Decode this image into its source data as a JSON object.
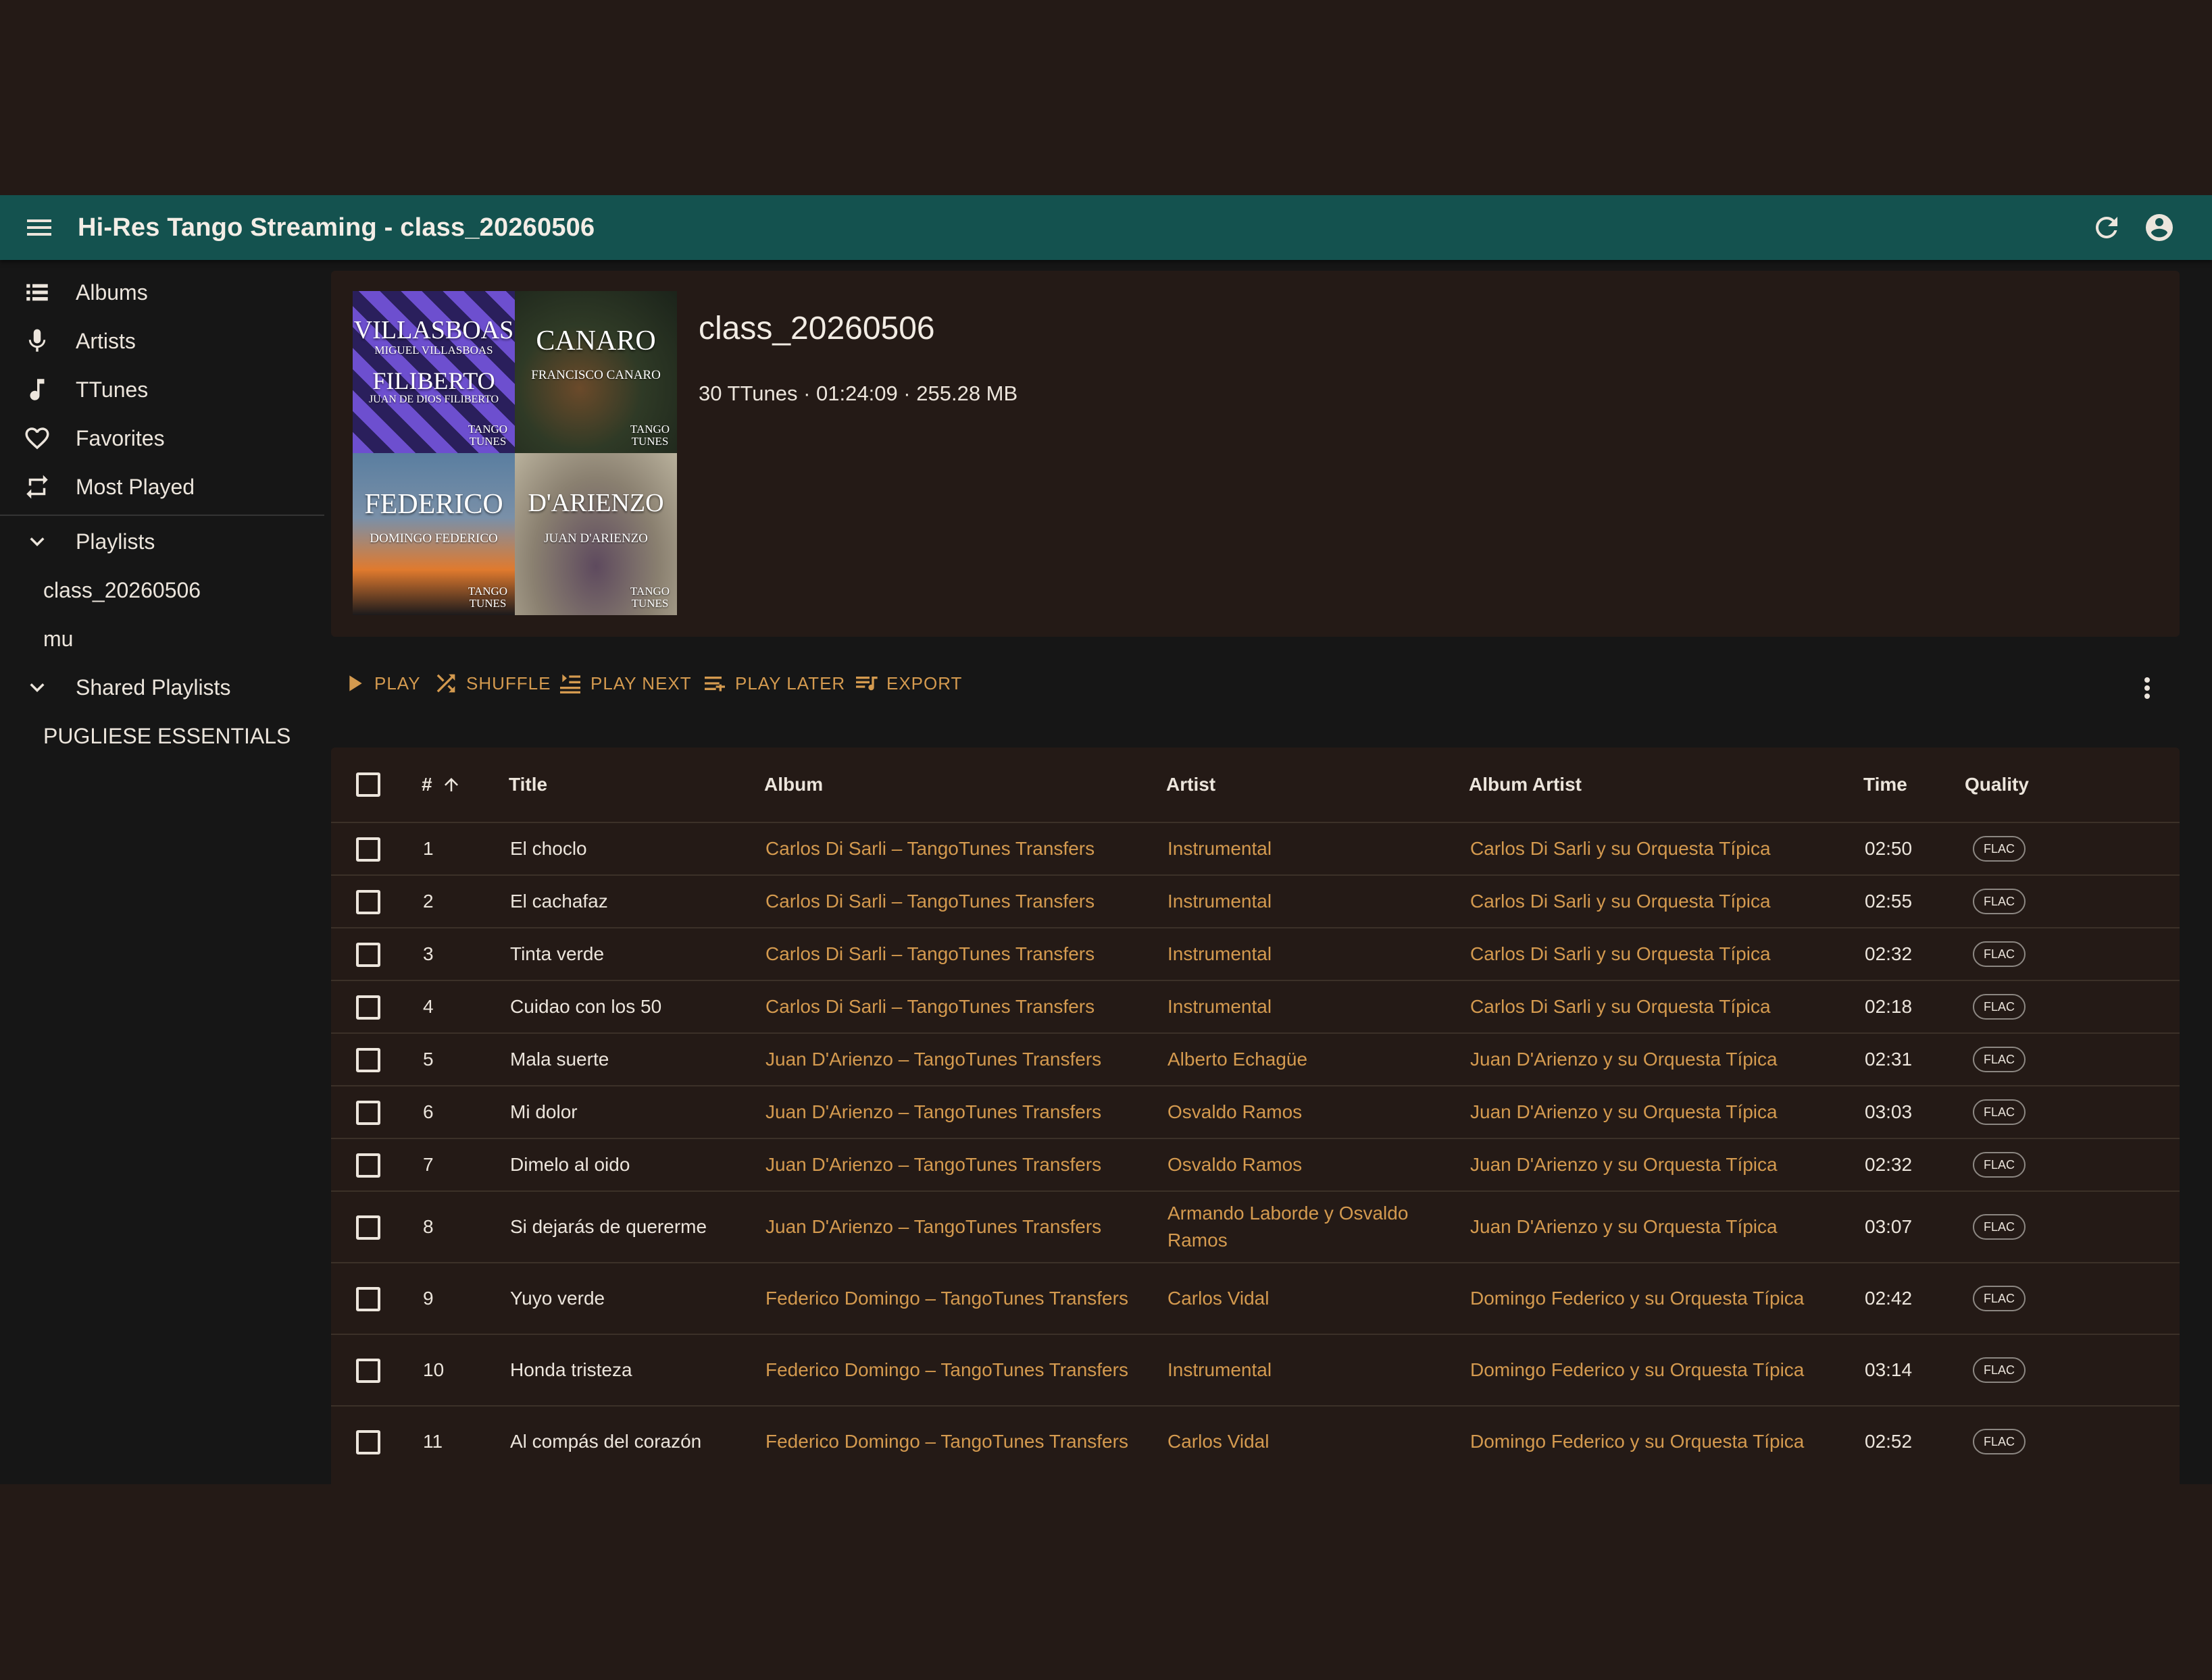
{
  "app": {
    "title": "Hi-Res Tango Streaming - class_20260506"
  },
  "sidebar": {
    "items": [
      {
        "label": "Albums",
        "icon": "view-list-icon"
      },
      {
        "label": "Artists",
        "icon": "microphone-icon"
      },
      {
        "label": "TTunes",
        "icon": "music-note-icon"
      },
      {
        "label": "Favorites",
        "icon": "heart-icon"
      },
      {
        "label": "Most Played",
        "icon": "repeat-icon"
      }
    ],
    "playlists_label": "Playlists",
    "playlists": [
      "class_20260506",
      "mu"
    ],
    "shared_label": "Shared Playlists",
    "shared_playlists": [
      "PUGLIESE ESSENTIALS"
    ]
  },
  "playlist": {
    "name": "class_20260506",
    "meta": "30 TTunes · 01:24:09 · 255.28 MB",
    "covers": [
      {
        "name": "VILLASBOAS",
        "sub": "MIGUEL VILLASBOAS",
        "name2": "FILIBERTO",
        "sub2": "JUAN DE DIOS FILIBERTO",
        "brand": "TANGO TUNES"
      },
      {
        "name": "CANARO",
        "sub": "FRANCISCO CANARO",
        "brand": "TANGO TUNES"
      },
      {
        "name": "FEDERICO",
        "sub": "DOMINGO FEDERICO",
        "brand": "TANGO TUNES"
      },
      {
        "name": "D'ARIENZO",
        "sub": "JUAN D'ARIENZO",
        "brand": "TANGO TUNES"
      }
    ]
  },
  "toolbar": {
    "play": "PLAY",
    "shuffle": "SHUFFLE",
    "play_next": "PLAY NEXT",
    "play_later": "PLAY LATER",
    "export": "EXPORT"
  },
  "table": {
    "headers": {
      "num": "#",
      "title": "Title",
      "album": "Album",
      "artist": "Artist",
      "album_artist": "Album Artist",
      "time": "Time",
      "quality": "Quality"
    },
    "rows": [
      {
        "num": "1",
        "title": "El choclo",
        "album": "Carlos Di Sarli – TangoTunes Transfers",
        "artist": "Instrumental",
        "album_artist": "Carlos Di Sarli y su Orquesta Típica",
        "time": "02:50",
        "quality": "FLAC"
      },
      {
        "num": "2",
        "title": "El cachafaz",
        "album": "Carlos Di Sarli – TangoTunes Transfers",
        "artist": "Instrumental",
        "album_artist": "Carlos Di Sarli y su Orquesta Típica",
        "time": "02:55",
        "quality": "FLAC"
      },
      {
        "num": "3",
        "title": "Tinta verde",
        "album": "Carlos Di Sarli – TangoTunes Transfers",
        "artist": "Instrumental",
        "album_artist": "Carlos Di Sarli y su Orquesta Típica",
        "time": "02:32",
        "quality": "FLAC"
      },
      {
        "num": "4",
        "title": "Cuidao con los 50",
        "album": "Carlos Di Sarli – TangoTunes Transfers",
        "artist": "Instrumental",
        "album_artist": "Carlos Di Sarli y su Orquesta Típica",
        "time": "02:18",
        "quality": "FLAC"
      },
      {
        "num": "5",
        "title": "Mala suerte",
        "album": "Juan D'Arienzo – TangoTunes Transfers",
        "artist": "Alberto Echagüe",
        "album_artist": "Juan D'Arienzo y su Orquesta Típica",
        "time": "02:31",
        "quality": "FLAC"
      },
      {
        "num": "6",
        "title": "Mi dolor",
        "album": "Juan D'Arienzo – TangoTunes Transfers",
        "artist": "Osvaldo Ramos",
        "album_artist": "Juan D'Arienzo y su Orquesta Típica",
        "time": "03:03",
        "quality": "FLAC"
      },
      {
        "num": "7",
        "title": "Dimelo al oido",
        "album": "Juan D'Arienzo – TangoTunes Transfers",
        "artist": "Osvaldo Ramos",
        "album_artist": "Juan D'Arienzo y su Orquesta Típica",
        "time": "02:32",
        "quality": "FLAC"
      },
      {
        "num": "8",
        "title": "Si dejarás de quererme",
        "album": "Juan D'Arienzo – TangoTunes Transfers",
        "artist": "Armando Laborde y Osvaldo Ramos",
        "album_artist": "Juan D'Arienzo y su Orquesta Típica",
        "time": "03:07",
        "quality": "FLAC"
      },
      {
        "num": "9",
        "title": "Yuyo verde",
        "album": "Federico Domingo – TangoTunes Transfers",
        "artist": "Carlos Vidal",
        "album_artist": "Domingo Federico y su Orquesta Típica",
        "time": "02:42",
        "quality": "FLAC"
      },
      {
        "num": "10",
        "title": "Honda tristeza",
        "album": "Federico Domingo – TangoTunes Transfers",
        "artist": "Instrumental",
        "album_artist": "Domingo Federico y su Orquesta Típica",
        "time": "03:14",
        "quality": "FLAC"
      },
      {
        "num": "11",
        "title": "Al compás del corazón",
        "album": "Federico Domingo – TangoTunes Transfers",
        "artist": "Carlos Vidal",
        "album_artist": "Domingo Federico y su Orquesta Típica",
        "time": "02:52",
        "quality": "FLAC"
      }
    ]
  },
  "colors": {
    "appbar": "#14524f",
    "accent": "#d49a4f",
    "card": "#241a16",
    "background": "#161616"
  }
}
